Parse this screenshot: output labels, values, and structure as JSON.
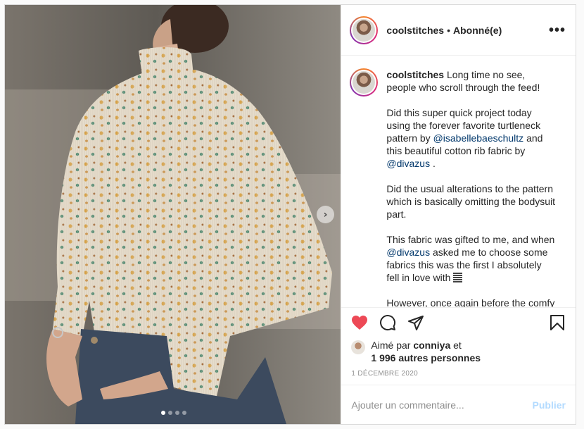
{
  "post": {
    "username": "coolstitches",
    "separator": "•",
    "follow_status": "Abonné(e)",
    "more_label": "•••"
  },
  "caption": {
    "username": "coolstitches",
    "p1_text": "Long time no see, people who scroll through the feed!",
    "p2_a": "Did this super quick project today using the forever favorite turtleneck pattern by",
    "p2_mention1": "@isabellebaeschultz",
    "p2_b": "and this beautiful cotton rib fabric by",
    "p2_mention2": "@divazus",
    "p2_c": ".",
    "p3": "Did the usual alterations to the pattern which is basically omitting the bodysuit part.",
    "p4_a": "This fabric was gifted to me, and when",
    "p4_mention": "@divazus",
    "p4_b": "asked me to choose some fabrics this was the first I absolutely fell in love with",
    "p5_partial": "However, once again before the comfy"
  },
  "actions": {
    "like_icon": "heart-icon",
    "comment_icon": "comment-icon",
    "share_icon": "paper-plane-icon",
    "save_icon": "bookmark-icon",
    "like_color": "#ed4956"
  },
  "likes": {
    "prefix": "Aimé par",
    "liker": "conniya",
    "and": "et",
    "others": "1 996 autres personnes"
  },
  "date": "1 DÉCEMBRE 2020",
  "comment": {
    "placeholder": "Ajouter un commentaire...",
    "publish_label": "Publier"
  },
  "carousel": {
    "next_label": "›",
    "slide_count": 4,
    "active_slide": 1
  }
}
